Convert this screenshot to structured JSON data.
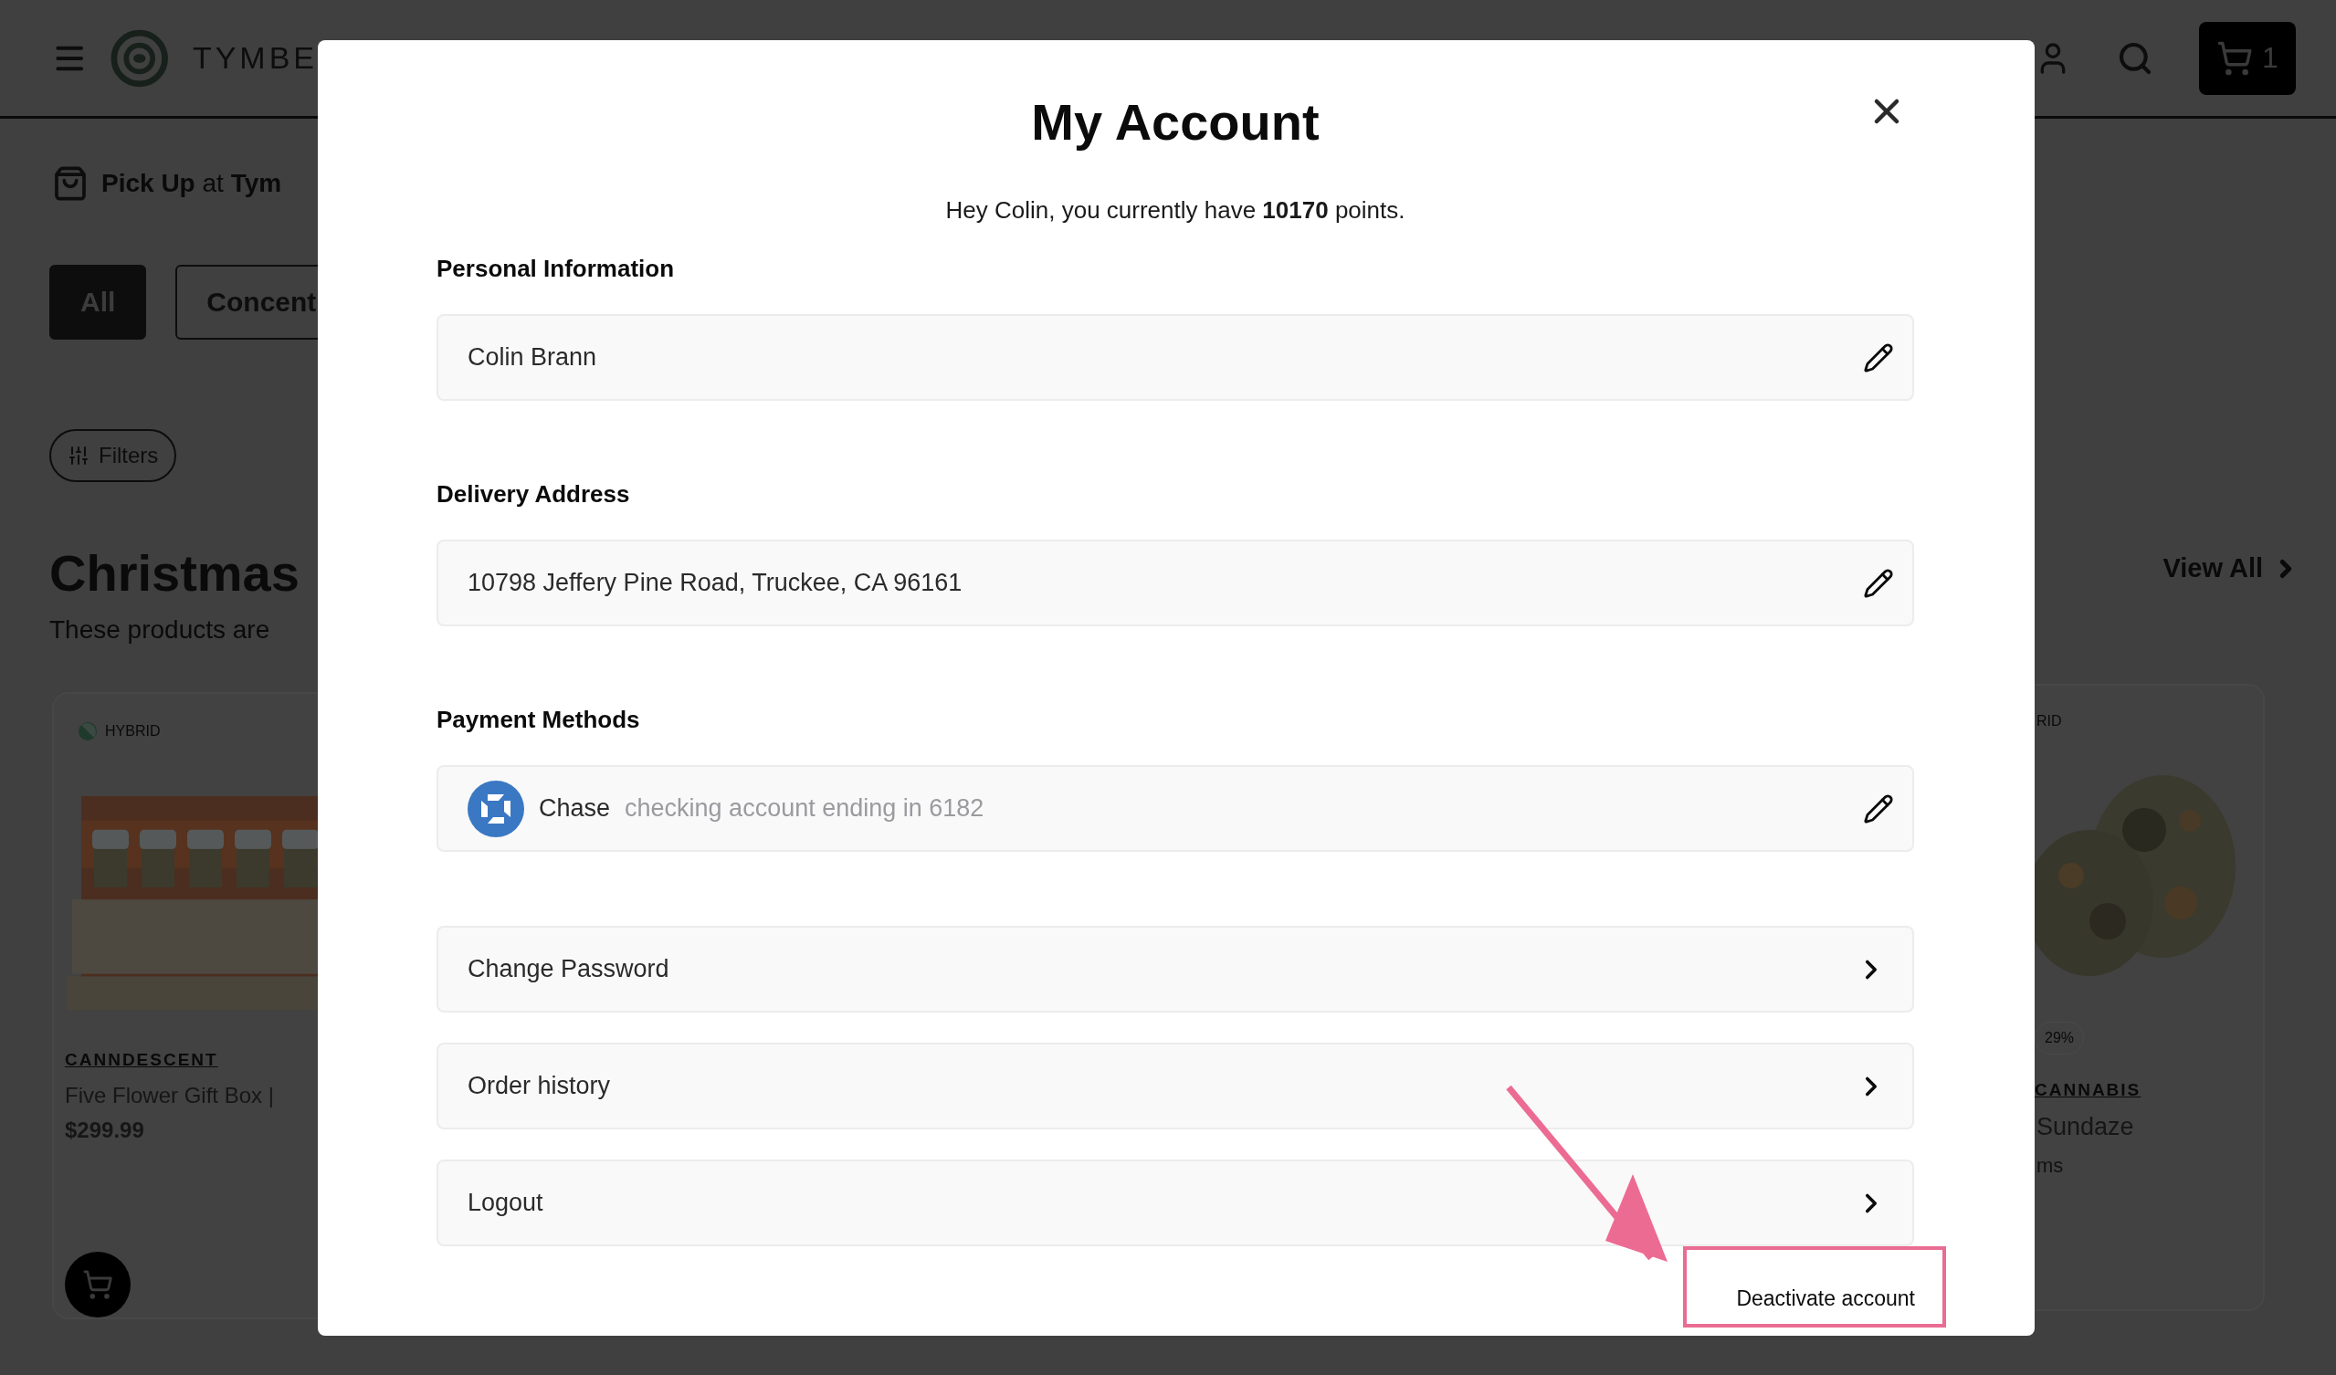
{
  "header": {
    "brand": "TYMBE",
    "cart_count": "1"
  },
  "pickup": "**Pick Up** at **Tym**",
  "categories": [
    {
      "label": "All",
      "selected": true
    },
    {
      "label": "Concent",
      "selected": false
    }
  ],
  "filters": "Filters",
  "collection": {
    "title": "Christmas",
    "subtitle": "These products are",
    "view_all": "View All"
  },
  "left_product": {
    "strain": "HYBRID",
    "brand": "CANNDESCENT",
    "name": "Five Flower Gift Box |",
    "price": "$299.99"
  },
  "right_product": {
    "strain": "RID",
    "potency": "29%",
    "brand": "CANNABIS",
    "name": "Sundaze",
    "size": "ms"
  },
  "modal": {
    "title": "My Account",
    "greeting": "Hey Colin, you currently have **10170** points.",
    "sections": [
      {
        "label": "Personal Information",
        "value": "Colin Brann",
        "kind": "text"
      },
      {
        "label": "Delivery Address",
        "value": "10798 Jeffery Pine Road, Truckee, CA 96161",
        "kind": "text"
      },
      {
        "label": "Payment Methods",
        "value": "Chase",
        "detail": "checking account ending in 6182",
        "kind": "bank"
      }
    ],
    "links": [
      "Change Password",
      "Order history",
      "Logout"
    ],
    "deactivate": "Deactivate account"
  }
}
